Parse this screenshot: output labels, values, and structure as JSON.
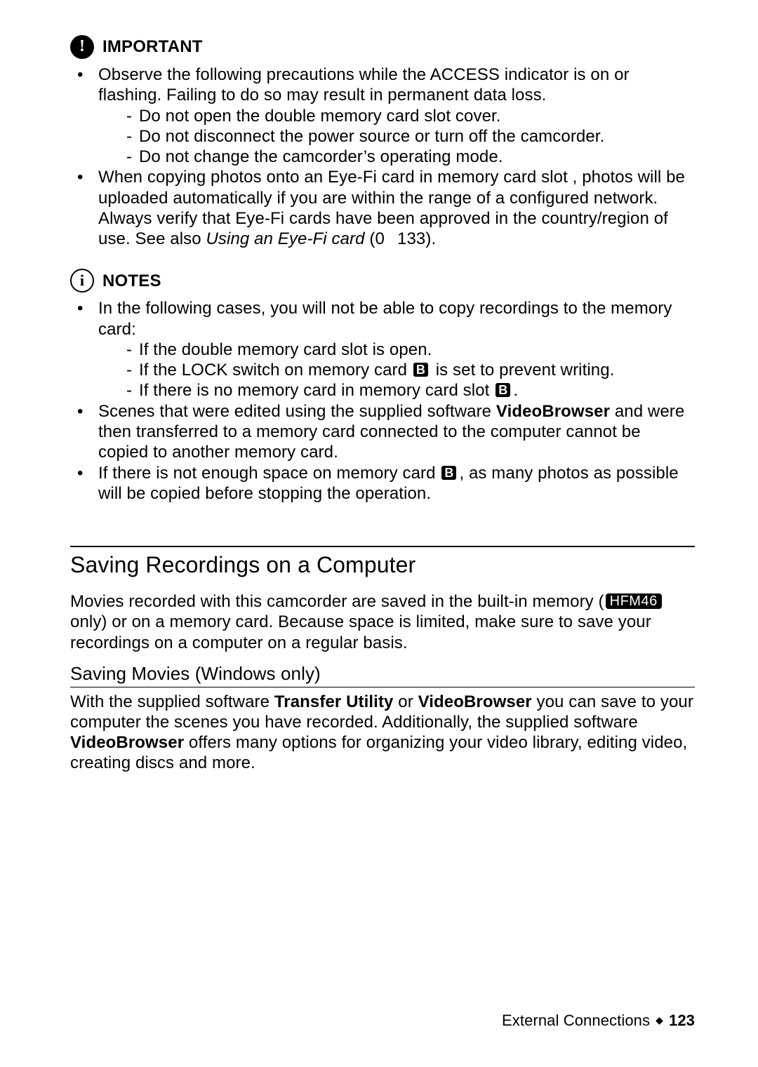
{
  "important": {
    "label": "IMPORTANT",
    "bullets": [
      {
        "text": "Observe the following precautions while the ACCESS indicator is on or flashing. Failing to do so may result in permanent data loss.",
        "sublines": [
          "Do not open the double memory card slot cover.",
          "Do not disconnect the power source or turn off the camcorder.",
          "Do not change the camcorder’s operating mode."
        ]
      },
      {
        "pre": "When copying photos onto an Eye-Fi card in memory card slot ",
        "post": ", photos will be uploaded automatically if you are within the range of a configured network. Always verify that Eye-Fi cards have been approved in the country/region of use. See also ",
        "italic": "Using an Eye-Fi card",
        "ref_open": " (",
        "ref_page": "133",
        "ref_close": ")."
      }
    ]
  },
  "notes": {
    "label": "NOTES",
    "bullets": [
      {
        "text": "In the following cases, you will not be able to copy recordings to the memory card:",
        "sublines": [
          {
            "type": "plain",
            "text": "If the double memory card slot is open."
          },
          {
            "type": "lock",
            "pre": "If the LOCK switch on memory card ",
            "badge": "B",
            "post": " is set to prevent writing."
          },
          {
            "type": "nocard",
            "pre": "If there is no memory card in memory card slot ",
            "badge": "B",
            "post": "."
          }
        ]
      },
      {
        "pre": "Scenes that were edited using the supplied software ",
        "bold1": "VideoBrowser",
        "post1": " and were then transferred to a memory card connected to the computer cannot be copied to another memory card."
      },
      {
        "pre": "If there is not enough space on memory card ",
        "badge": "B",
        "post": ", as many photos as possible will be copied before stopping the operation."
      }
    ]
  },
  "section": {
    "title": "Saving Recordings on a Computer",
    "para_pre": "Movies recorded with this camcorder are saved in the built-in memory (",
    "model_badge": "HFM46",
    "para_post": " only) or on a memory card. Because space is limited, make sure to save your recordings on a computer on a regular basis.",
    "subheading": "Saving Movies (Windows only)",
    "body_pre": "With the supplied software ",
    "body_b1": "Transfer Utility",
    "body_mid1": " or ",
    "body_b2": "VideoBrowser",
    "body_mid2": " you can save to your computer the scenes you have recorded. Additionally, the supplied software ",
    "body_b3": "VideoBrowser",
    "body_post": " offers many options for organizing your video library, editing video, creating discs and more."
  },
  "footer": {
    "chapter": "External Connections",
    "page": "123"
  }
}
